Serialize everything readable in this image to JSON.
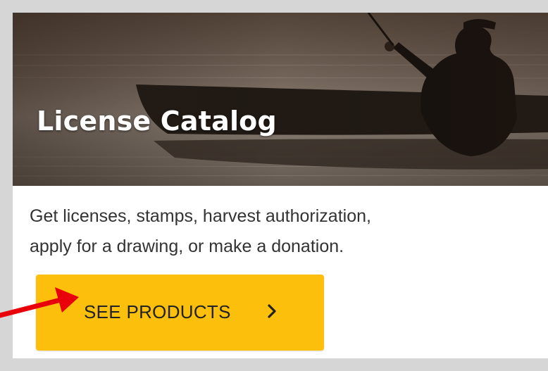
{
  "card": {
    "title": "License Catalog",
    "description_line1": "Get licenses, stamps, harvest authorization,",
    "description_line2": "apply for a drawing, or make a donation.",
    "hero_image": "silhouette of angler fishing from a kayak at dusk",
    "cta_label": "SEE PRODUCTS",
    "cta_icon": "chevron-right-icon"
  },
  "annotation": {
    "pointer": "red-arrow-icon"
  },
  "colors": {
    "frame": "#d6d6d6",
    "cta_background": "#fcbf0b",
    "text": "#333333",
    "arrow": "#e8000b",
    "title": "#ffffff"
  }
}
